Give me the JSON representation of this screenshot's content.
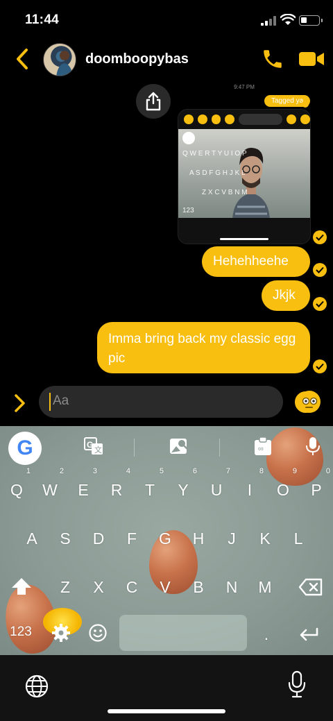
{
  "status": {
    "time": "11:44"
  },
  "header": {
    "username": "doomboopybas"
  },
  "chat": {
    "timestamp": "9:47 PM",
    "tagged_label": "Tagged ya",
    "messages": [
      "Hehehheehe",
      "Jkjk",
      "Imma bring back my classic egg pic"
    ]
  },
  "composer": {
    "placeholder": "Aa"
  },
  "keyboard": {
    "row1": [
      {
        "key": "Q",
        "num": "1"
      },
      {
        "key": "W",
        "num": "2"
      },
      {
        "key": "E",
        "num": "3"
      },
      {
        "key": "R",
        "num": "4"
      },
      {
        "key": "T",
        "num": "5"
      },
      {
        "key": "Y",
        "num": "6"
      },
      {
        "key": "U",
        "num": "7"
      },
      {
        "key": "I",
        "num": "8"
      },
      {
        "key": "O",
        "num": "9"
      },
      {
        "key": "P",
        "num": "0"
      }
    ],
    "row2": [
      "A",
      "S",
      "D",
      "F",
      "G",
      "H",
      "J",
      "K",
      "L"
    ],
    "row3": [
      "Z",
      "X",
      "C",
      "V",
      "B",
      "N",
      "M"
    ],
    "numbers_key": "123",
    "period_key": ".",
    "google_logo": "G"
  },
  "colors": {
    "accent": "#f8be10",
    "background": "#000000",
    "input_bg": "#2a2a2a"
  },
  "icons": [
    "back-chevron-icon",
    "phone-icon",
    "video-camera-icon",
    "share-icon",
    "check-icon",
    "expand-chevron-icon",
    "emoji-icon",
    "sticker-icon",
    "translate-icon",
    "search-image-icon",
    "clipboard-icon",
    "mic-icon",
    "shift-icon",
    "backspace-icon",
    "settings-icon",
    "keyboard-emoji-icon",
    "return-icon",
    "globe-icon"
  ]
}
